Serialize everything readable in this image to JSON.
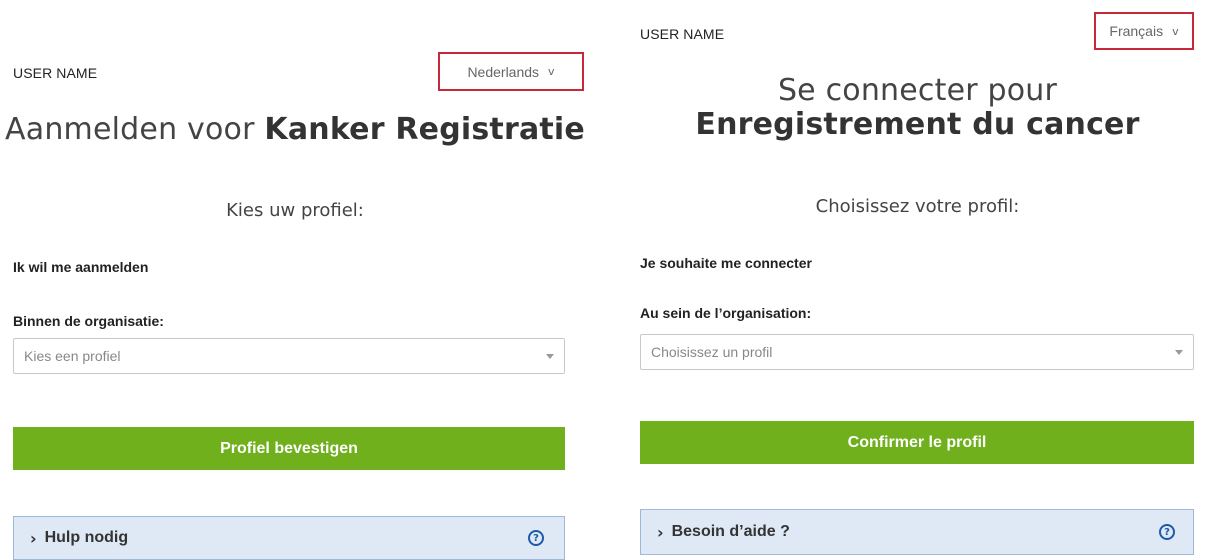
{
  "left": {
    "username": "USER NAME",
    "language": "Nederlands",
    "title_light": "Aanmelden voor",
    "title_bold": "Kanker Registratie",
    "subtitle": "Kies uw profiel:",
    "login_label": "Ik wil me aanmelden",
    "org_label": "Binnen de organisatie:",
    "profile_placeholder": "Kies een profiel",
    "confirm_button": "Profiel bevestigen",
    "help_label": "Hulp nodig"
  },
  "right": {
    "username": "USER NAME",
    "language": "Français",
    "title_light": "Se connecter pour",
    "title_bold": "Enregistrement du cancer",
    "subtitle": "Choisissez votre profil:",
    "login_label": "Je souhaite me connecter",
    "org_label": "Au sein de l’organisation:",
    "profile_placeholder": "Choisissez un profil",
    "confirm_button": "Confirmer le profil",
    "help_label": "Besoin d’aide ?"
  },
  "icons": {
    "language_chevron": "chevron-down-icon",
    "select_caret": "caret-down-icon",
    "help_arrow": "chevron-right-icon",
    "help_question": "question-circle-icon"
  },
  "colors": {
    "highlight_border": "#c8283a",
    "confirm_button": "#6fb01c",
    "help_background": "#dfe8f5",
    "help_icon": "#1e5aa8"
  }
}
